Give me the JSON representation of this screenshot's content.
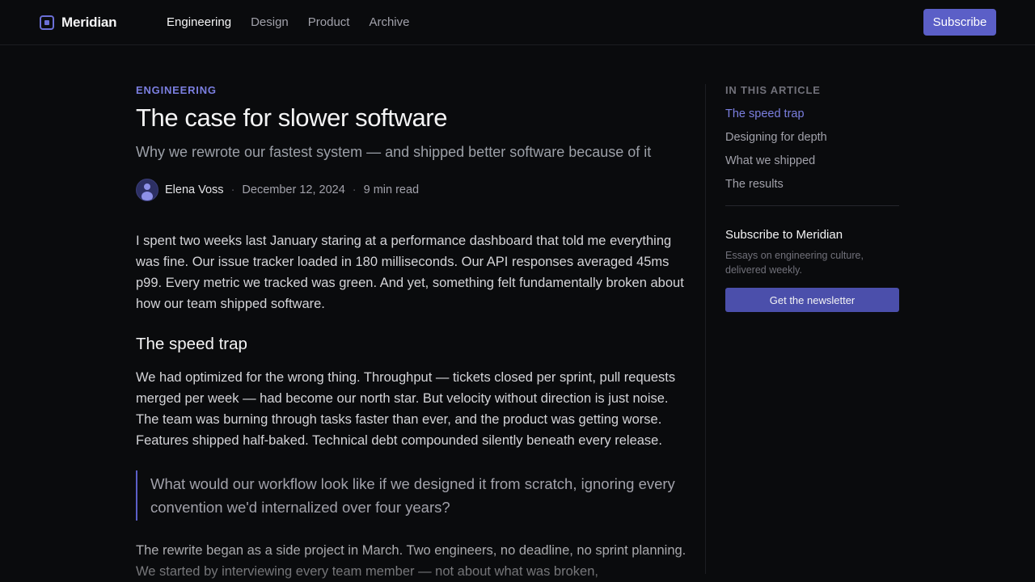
{
  "header": {
    "brand": "Meridian",
    "nav": [
      {
        "label": "Engineering",
        "active": true
      },
      {
        "label": "Design",
        "active": false
      },
      {
        "label": "Product",
        "active": false
      },
      {
        "label": "Archive",
        "active": false
      }
    ],
    "subscribe_label": "Subscribe"
  },
  "article": {
    "kicker": "ENGINEERING",
    "title": "The case for slower software",
    "subtitle": "Why we rewrote our fastest system — and shipped better software because of it",
    "author": "Elena Voss",
    "date": "December 12, 2024",
    "read_time": "9 min read",
    "paragraph_1": "I spent two weeks last January staring at a performance dashboard that told me everything was fine. Our issue tracker loaded in 180 milliseconds. Our API responses averaged 45ms p99. Every metric we tracked was green. And yet, something felt fundamentally broken about how our team shipped software.",
    "heading_1": "The speed trap",
    "paragraph_2": "We had optimized for the wrong thing. Throughput — tickets closed per sprint, pull requests merged per week — had become our north star. But velocity without direction is just noise. The team was burning through tasks faster than ever, and the product was getting worse. Features shipped half-baked. Technical debt compounded silently beneath every release.",
    "quote": "What would our workflow look like if we designed it from scratch, ignoring every convention we'd internalized over four years?",
    "paragraph_3": "The rewrite began as a side project in March. Two engineers, no deadline, no sprint planning. We started by interviewing every team member — not about what was broken,"
  },
  "sidebar": {
    "toc_heading": "IN THIS ARTICLE",
    "toc": [
      {
        "label": "The speed trap",
        "active": true
      },
      {
        "label": "Designing for depth",
        "active": false
      },
      {
        "label": "What we shipped",
        "active": false
      },
      {
        "label": "The results",
        "active": false
      }
    ],
    "subscribe_title": "Subscribe to Meridian",
    "subscribe_desc": "Essays on engineering culture, delivered weekly.",
    "newsletter_label": "Get the newsletter"
  },
  "icons": {
    "brand": "meridian-logo-icon",
    "avatar": "user-avatar-icon"
  },
  "colors": {
    "background": "#0a0b0d",
    "accent": "#5b5fc7",
    "accent_text": "#7b7fe0"
  }
}
